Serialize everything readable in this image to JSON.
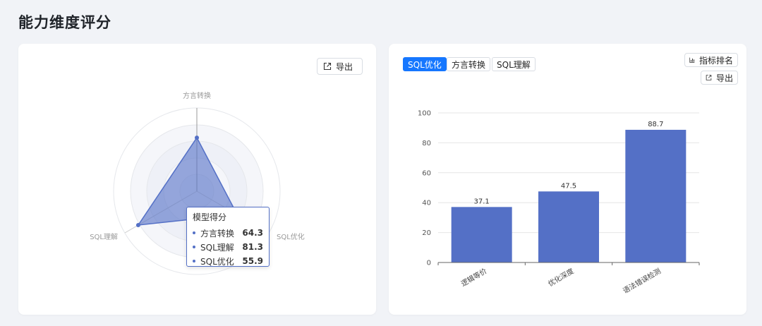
{
  "page": {
    "title": "能力维度评分"
  },
  "radar_card": {
    "export_label": "导出",
    "tooltip": {
      "title": "模型得分",
      "rows": [
        {
          "name": "方言转换",
          "value": "64.3"
        },
        {
          "name": "SQL理解",
          "value": "81.3"
        },
        {
          "name": "SQL优化",
          "value": "55.9"
        }
      ]
    }
  },
  "bar_card": {
    "tabs": [
      "SQL优化",
      "方言转换",
      "SQL理解"
    ],
    "active_tab": "SQL优化",
    "rank_label": "指标排名",
    "export_label": "导出"
  },
  "chart_data": [
    {
      "type": "radar",
      "indicators": [
        "方言转换",
        "SQL优化",
        "SQL理解"
      ],
      "max": 100,
      "series": [
        {
          "name": "模型得分",
          "values": [
            64.3,
            55.9,
            81.3
          ]
        }
      ],
      "color": "#5470c6"
    },
    {
      "type": "bar",
      "categories": [
        "逻辑等价",
        "优化深度",
        "语法错误检测"
      ],
      "values": [
        37.1,
        47.5,
        88.7
      ],
      "ylim": [
        0,
        100
      ],
      "yticks": [
        0,
        20,
        40,
        60,
        80,
        100
      ],
      "grid": true,
      "color": "#5470c6"
    }
  ]
}
